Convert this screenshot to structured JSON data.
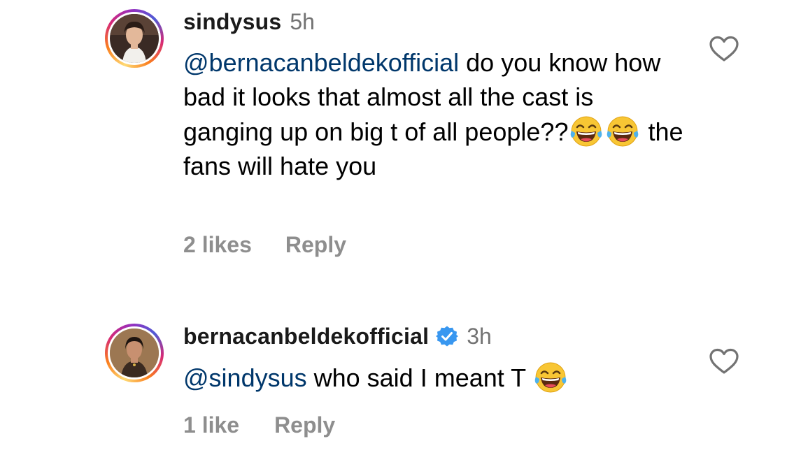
{
  "comments": [
    {
      "username": "sindysus",
      "verified": false,
      "time": "5h",
      "mention": "@bernacanbeldekofficial",
      "text_before_emoji": " do you know how bad it looks that almost all the cast is ganging up on big t of all people??",
      "emojis": [
        "face-with-tears-of-joy",
        "face-with-tears-of-joy"
      ],
      "text_after_emoji": " the fans will hate you",
      "likes": "2 likes",
      "reply_label": "Reply",
      "avatar": "profile-photo-sindysus"
    },
    {
      "username": "bernacanbeldekofficial",
      "verified": true,
      "time": "3h",
      "mention": "@sindysus",
      "text_before_emoji": " who said I meant T ",
      "emojis": [
        "face-with-tears-of-joy"
      ],
      "text_after_emoji": "",
      "likes": "1 like",
      "reply_label": "Reply",
      "avatar": "profile-photo-bernacanbeldekofficial"
    }
  ],
  "colors": {
    "mention": "#00376b",
    "secondary_text": "#737373",
    "action_text": "#8e8e8e",
    "verified_badge": "#3897f0",
    "heart_outline": "#737373"
  },
  "icons": {
    "like": "heart-outline-icon",
    "verified": "verified-badge-icon",
    "emoji": "face-with-tears-of-joy"
  }
}
